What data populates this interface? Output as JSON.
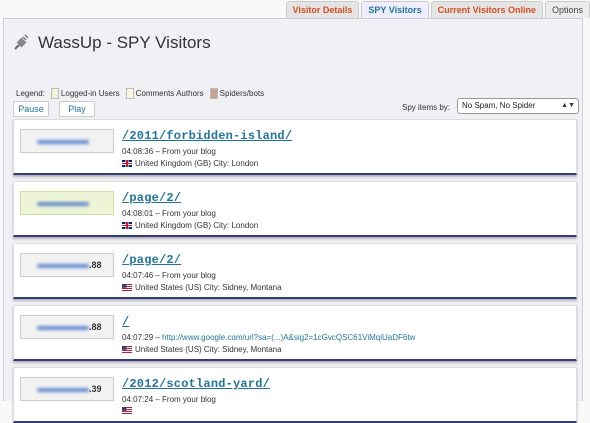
{
  "tabs": [
    {
      "label": "Visitor Details",
      "active": false
    },
    {
      "label": "SPY Visitors",
      "active": true
    },
    {
      "label": "Current Visitors Online",
      "active": false
    },
    {
      "label": "Options",
      "active": false
    }
  ],
  "header": {
    "title": "WassUp - SPY Visitors",
    "icon": "plug-icon"
  },
  "legend": {
    "label": "Legend:",
    "items": [
      {
        "label": "Logged-in Users",
        "color": "#eef5d6"
      },
      {
        "label": "Comments Authors",
        "color": "#fbf6dc"
      },
      {
        "label": "Spiders/bots",
        "color": "#c9a492"
      }
    ]
  },
  "controls": {
    "pause_label": "Pause",
    "play_label": "Play",
    "spy_items_label": "Spy items by:",
    "spy_items_value": "No Spam, No Spider"
  },
  "entries": [
    {
      "ip_suffix": "",
      "logged_in": false,
      "url": "/2011/forbidden-island/",
      "time": "04:08:36",
      "referrer": "From your blog",
      "flag": "uk-flag",
      "location": "United Kingdom (GB) City: London"
    },
    {
      "ip_suffix": "",
      "logged_in": true,
      "url": "/page/2/",
      "time": "04:08:01",
      "referrer": "From your blog",
      "flag": "uk-flag",
      "location": "United Kingdom (GB) City: London"
    },
    {
      "ip_suffix": ".88",
      "logged_in": false,
      "url": "/page/2/",
      "time": "04:07:46",
      "referrer": "From your blog",
      "flag": "us-flag",
      "location": "United States (US) City: Sidney, Montana"
    },
    {
      "ip_suffix": ".88",
      "logged_in": false,
      "url": "/",
      "time": "04:07:29",
      "referrer": "http://www.google.com/url?sa=(...)A&sig2=1cGvcQSC61ViMqiUaDF6tw",
      "flag": "us-flag",
      "location": "United States (US) City: Sidney, Montana"
    },
    {
      "ip_suffix": ".39",
      "logged_in": false,
      "url": "/2012/scotland-yard/",
      "time": "04:07:24",
      "referrer": "From your blog",
      "flag": "us-flag",
      "location": ""
    }
  ]
}
